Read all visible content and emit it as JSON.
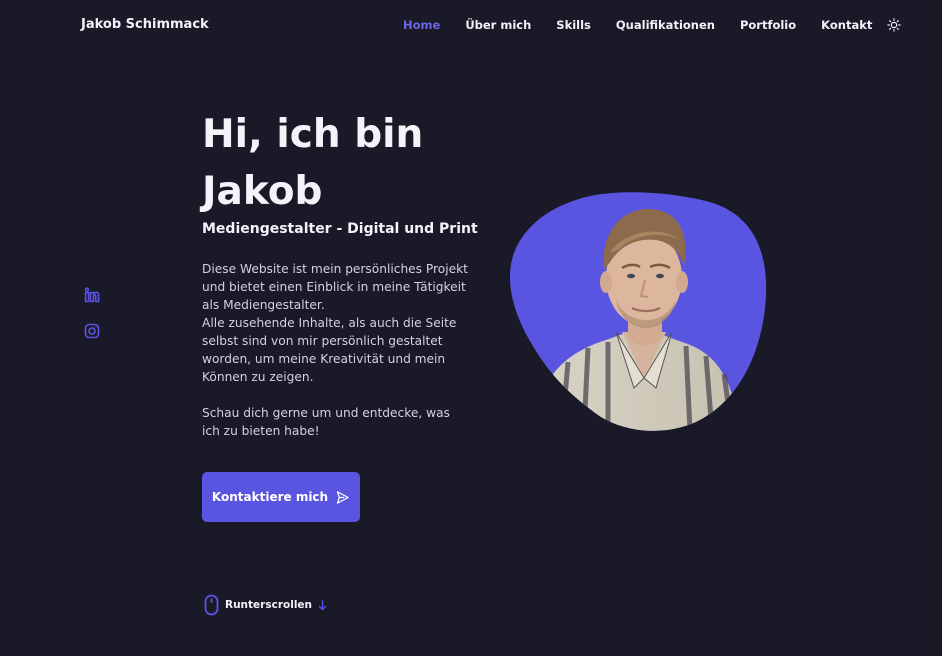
{
  "header": {
    "brand": "Jakob Schimmack",
    "nav": [
      {
        "label": "Home",
        "active": true
      },
      {
        "label": "Über mich",
        "active": false
      },
      {
        "label": "Skills",
        "active": false
      },
      {
        "label": "Qualifikationen",
        "active": false
      },
      {
        "label": "Portfolio",
        "active": false
      },
      {
        "label": "Kontakt",
        "active": false
      }
    ],
    "theme_toggle_icon": "sun-icon"
  },
  "social": [
    {
      "icon": "linkedin-icon"
    },
    {
      "icon": "instagram-icon"
    }
  ],
  "hero": {
    "title": "Hi, ich bin Jakob",
    "subtitle": "Mediengestalter - Digital und Print",
    "description": "Diese Website ist mein persönliches Projekt und bietet einen Einblick in meine Tätigkeit als Mediengestalter.\nAlle zusehende Inhalte, als auch die Seite selbst sind von mir persönlich gestaltet worden, um meine Kreativität und mein Können zu zeigen.\n\nSchau dich gerne um und entdecke, was ich zu bieten habe!",
    "cta_label": "Kontaktiere mich",
    "cta_icon": "send-icon",
    "photo_icon": "profile-photo"
  },
  "scroll": {
    "label": "Runterscrollen",
    "icon": "mouse-icon",
    "arrow_icon": "arrow-down-icon"
  },
  "colors": {
    "background": "#1a1928",
    "accent": "#5a55e0",
    "accent_text": "#6b67ea",
    "text": "#f4f3f9"
  }
}
